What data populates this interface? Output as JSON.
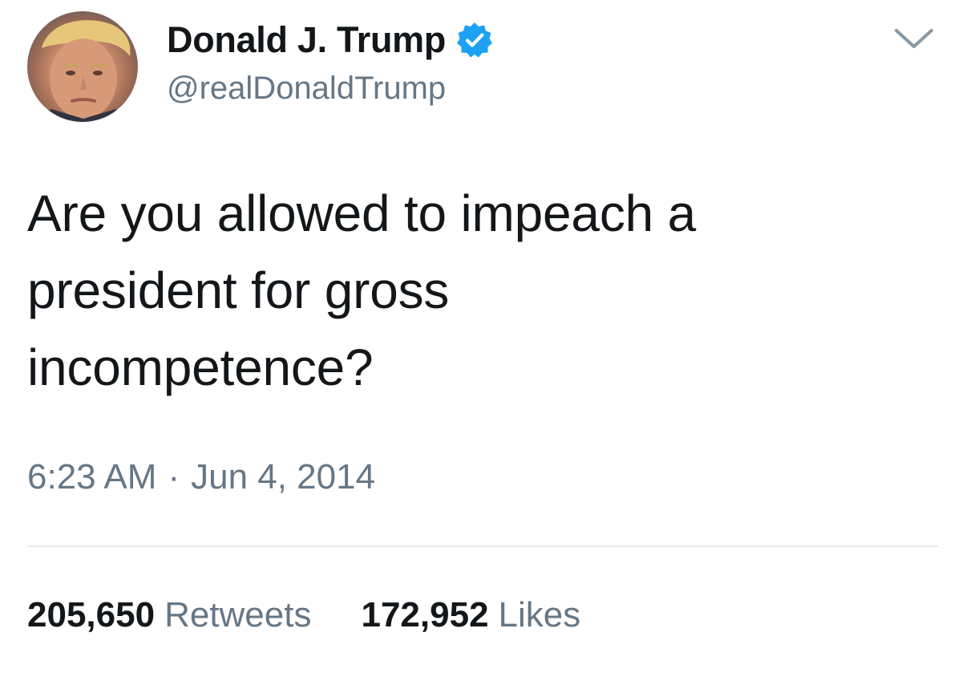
{
  "author": {
    "display_name": "Donald J. Trump",
    "handle": "@realDonaldTrump",
    "verified": true,
    "verified_color": "#1da1f2"
  },
  "tweet": {
    "text_lines": [
      "Are you allowed to impeach a",
      "president for gross",
      "incompetence?"
    ],
    "time": "6:23 AM",
    "separator": "·",
    "date": "Jun 4, 2014"
  },
  "stats": {
    "retweets_count": "205,650",
    "retweets_label": "Retweets",
    "likes_count": "172,952",
    "likes_label": "Likes"
  },
  "icons": {
    "verified": "verified-badge-icon",
    "menu": "chevron-down-icon",
    "avatar": "profile-photo"
  },
  "colors": {
    "text_primary": "#14171a",
    "text_secondary": "#657786",
    "divider": "#e6ecf0"
  }
}
